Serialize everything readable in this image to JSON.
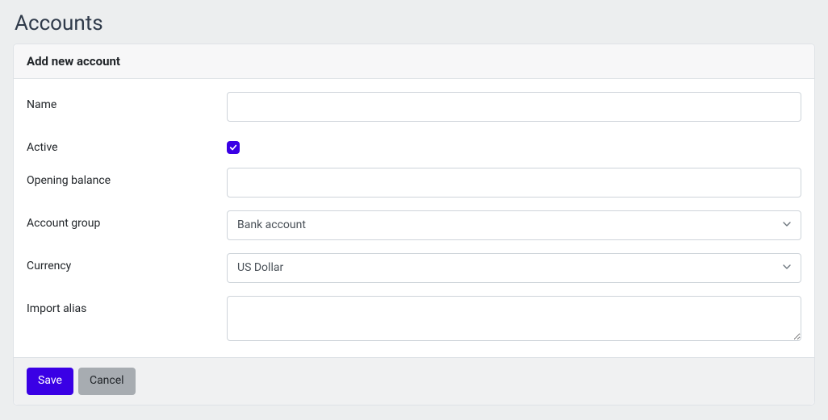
{
  "page": {
    "title": "Accounts"
  },
  "card": {
    "title": "Add new account"
  },
  "form": {
    "labels": {
      "name": "Name",
      "active": "Active",
      "opening_balance": "Opening balance",
      "account_group": "Account group",
      "currency": "Currency",
      "import_alias": "Import alias"
    },
    "values": {
      "name": "",
      "active_checked": true,
      "opening_balance": "",
      "account_group": "Bank account",
      "currency": "US Dollar",
      "import_alias": ""
    }
  },
  "buttons": {
    "save": "Save",
    "cancel": "Cancel"
  }
}
